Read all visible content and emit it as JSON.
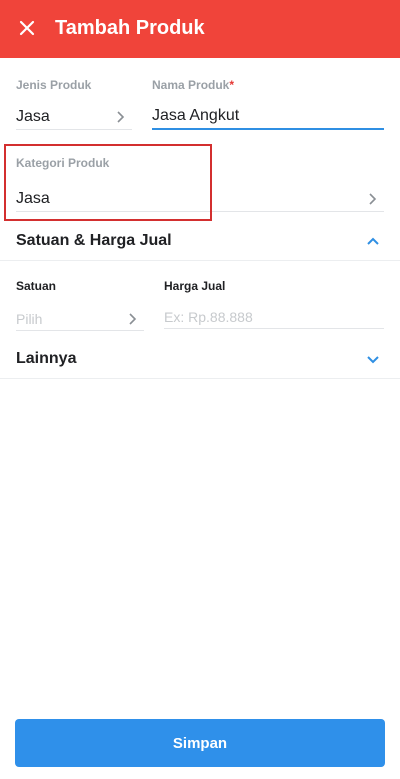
{
  "header": {
    "title": "Tambah Produk",
    "close_icon": "close-icon"
  },
  "form": {
    "jenis_produk": {
      "label": "Jenis Produk",
      "value": "Jasa"
    },
    "nama_produk": {
      "label": "Nama Produk",
      "required_mark": "*",
      "value": "Jasa Angkut"
    },
    "kategori_produk": {
      "label": "Kategori Produk",
      "value": "Jasa"
    }
  },
  "satuan_harga": {
    "title": "Satuan & Harga Jual",
    "satuan": {
      "label": "Satuan",
      "placeholder": "Pilih"
    },
    "harga_jual": {
      "label": "Harga Jual",
      "placeholder": "Ex: Rp.88.888"
    }
  },
  "lainnya": {
    "title": "Lainnya"
  },
  "footer": {
    "save_label": "Simpan"
  },
  "colors": {
    "header": "#f0443a",
    "accent": "#2f90ea",
    "highlight": "#d32f2f"
  }
}
